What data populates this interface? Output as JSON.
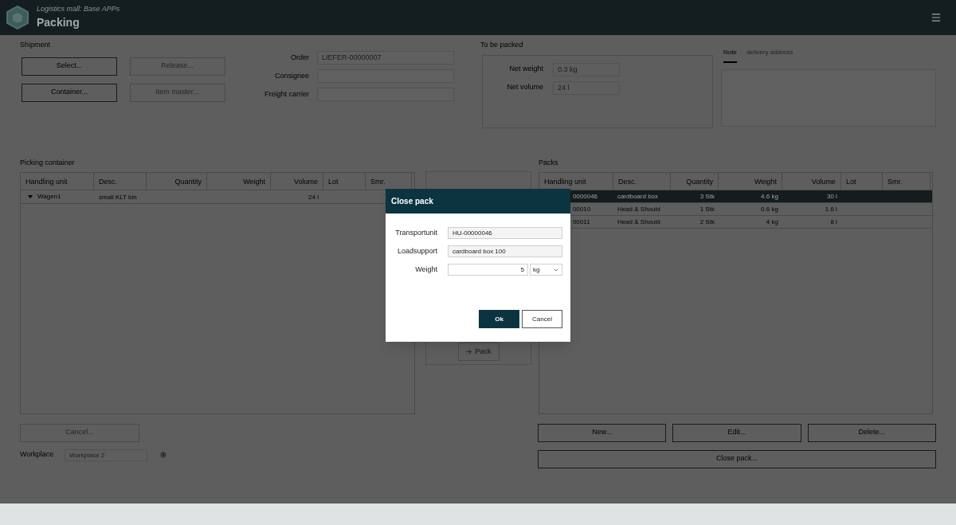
{
  "app_header": {
    "subtitle": "Logistics mall: Base APPs",
    "title": "Packing"
  },
  "shipment": {
    "label": "Shipment",
    "buttons": [
      {
        "label": "Select...",
        "disabled": false
      },
      {
        "label": "Release...",
        "disabled": true
      },
      {
        "label": "Container...",
        "disabled": false
      },
      {
        "label": "Item master...",
        "disabled": true
      }
    ]
  },
  "order_fields": [
    {
      "label": "Order",
      "value": "LIEFER-00000007"
    },
    {
      "label": "Consignee"
    },
    {
      "label": "Freight carrier"
    }
  ],
  "to_be_packed": {
    "label": "To be packed",
    "fields": [
      {
        "label": "Net weight",
        "value": "0.3 kg"
      },
      {
        "label": "Net volume",
        "value": "24 l"
      }
    ]
  },
  "info_tabs": [
    {
      "label": "Note",
      "selected": true
    },
    {
      "label": "delivery address",
      "selected": false
    }
  ],
  "picking_container": {
    "label": "Picking container",
    "columns": [
      "Handling unit",
      "Desc.",
      "Quantity",
      "Weight",
      "Volume",
      "Lot",
      "Smr."
    ],
    "rows": [
      {
        "handling_unit": "Wagen1",
        "desc": "small KLT bin",
        "volume": "24 l",
        "expanded": true
      }
    ]
  },
  "pack_button": {
    "label": "Pack",
    "disabled": true
  },
  "packs": {
    "label": "Packs",
    "columns": [
      "Handling unit",
      "Desc.",
      "Quantity",
      "Weight",
      "Volume",
      "Lot",
      "Smr."
    ],
    "rows": [
      {
        "handling_unit": "0000046",
        "desc": "cardboard box",
        "quantity": "3 Stk",
        "weight": "4.6 kg",
        "volume": "30 l",
        "selected": true
      },
      {
        "handling_unit": "00010",
        "desc": "Head & Should",
        "quantity": "1 Stk",
        "weight": "0.6 kg",
        "volume": "1.6 l",
        "selected": false
      },
      {
        "handling_unit": "00011",
        "desc": "Head & Should",
        "quantity": "2 Stk",
        "weight": "4 kg",
        "volume": "8 l",
        "selected": false
      }
    ]
  },
  "cancel_button": {
    "label": "Cancel...",
    "disabled": true
  },
  "workplace": {
    "label": "Workplace",
    "value": "Workplace 2"
  },
  "pack_actions": [
    {
      "label": "New..."
    },
    {
      "label": "Edit..."
    },
    {
      "label": "Delete..."
    }
  ],
  "close_pack_button": {
    "label": "Close pack..."
  },
  "dialog": {
    "title": "Close pack",
    "fields": [
      {
        "label": "Transportunit",
        "value": "HU-00000046",
        "kind": "text"
      },
      {
        "label": "Loadsupport",
        "value": "cardboard box 100",
        "kind": "text"
      },
      {
        "label": "Weight",
        "value": "5",
        "unit": "kg",
        "kind": "number_unit"
      }
    ],
    "buttons": [
      {
        "label": "Ok",
        "kind": "primary"
      },
      {
        "label": "Cancel",
        "kind": "secondary"
      }
    ]
  }
}
